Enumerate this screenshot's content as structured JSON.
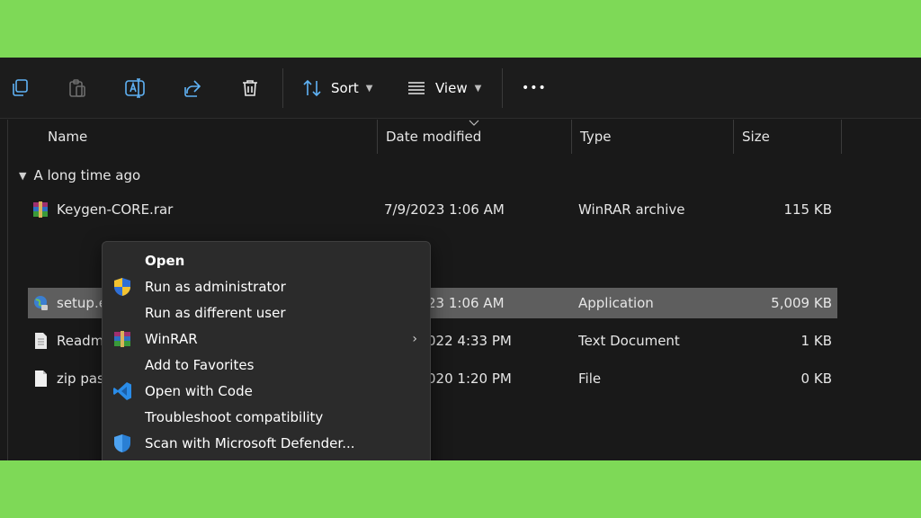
{
  "toolbar": {
    "sort_label": "Sort",
    "view_label": "View",
    "more_label": "•••"
  },
  "columns": {
    "name": "Name",
    "date_modified": "Date modified",
    "type": "Type",
    "size": "Size"
  },
  "group": {
    "label": "A long time ago"
  },
  "files": [
    {
      "name": "Keygen-CORE.rar",
      "date": "7/9/2023 1:06 AM",
      "type": "WinRAR archive",
      "size": "115 KB",
      "icon": "winrar-archive-icon"
    },
    {
      "name": "setup.e",
      "date": "23 1:06 AM",
      "type": "Application",
      "size": "5,009 KB",
      "icon": "application-globe-icon",
      "selected": true
    },
    {
      "name": "Readm",
      "date": "022 4:33 PM",
      "type": "Text Document",
      "size": "1 KB",
      "icon": "text-document-icon"
    },
    {
      "name": "zip pas",
      "date": "020 1:20 PM",
      "type": "File",
      "size": "0 KB",
      "icon": "blank-file-icon"
    }
  ],
  "context_menu": {
    "items": [
      {
        "label": "Open",
        "icon": "none",
        "bold": true
      },
      {
        "label": "Run as administrator",
        "icon": "uac-shield-icon"
      },
      {
        "label": "Run as different user",
        "icon": "none"
      },
      {
        "label": "WinRAR",
        "icon": "winrar-icon",
        "submenu": true
      },
      {
        "label": "Add to Favorites",
        "icon": "none"
      },
      {
        "label": "Open with Code",
        "icon": "vscode-icon"
      },
      {
        "label": "Troubleshoot compatibility",
        "icon": "none"
      },
      {
        "label": "Scan with Microsoft Defender...",
        "icon": "defender-shield-icon"
      }
    ],
    "submenu_arrow": "›"
  },
  "colors": {
    "background_green": "#7ed957",
    "window_bg": "#191919",
    "selection_bg": "#5e5e5e",
    "menu_bg": "#2b2b2b",
    "accent_blue": "#4ea3f1"
  }
}
